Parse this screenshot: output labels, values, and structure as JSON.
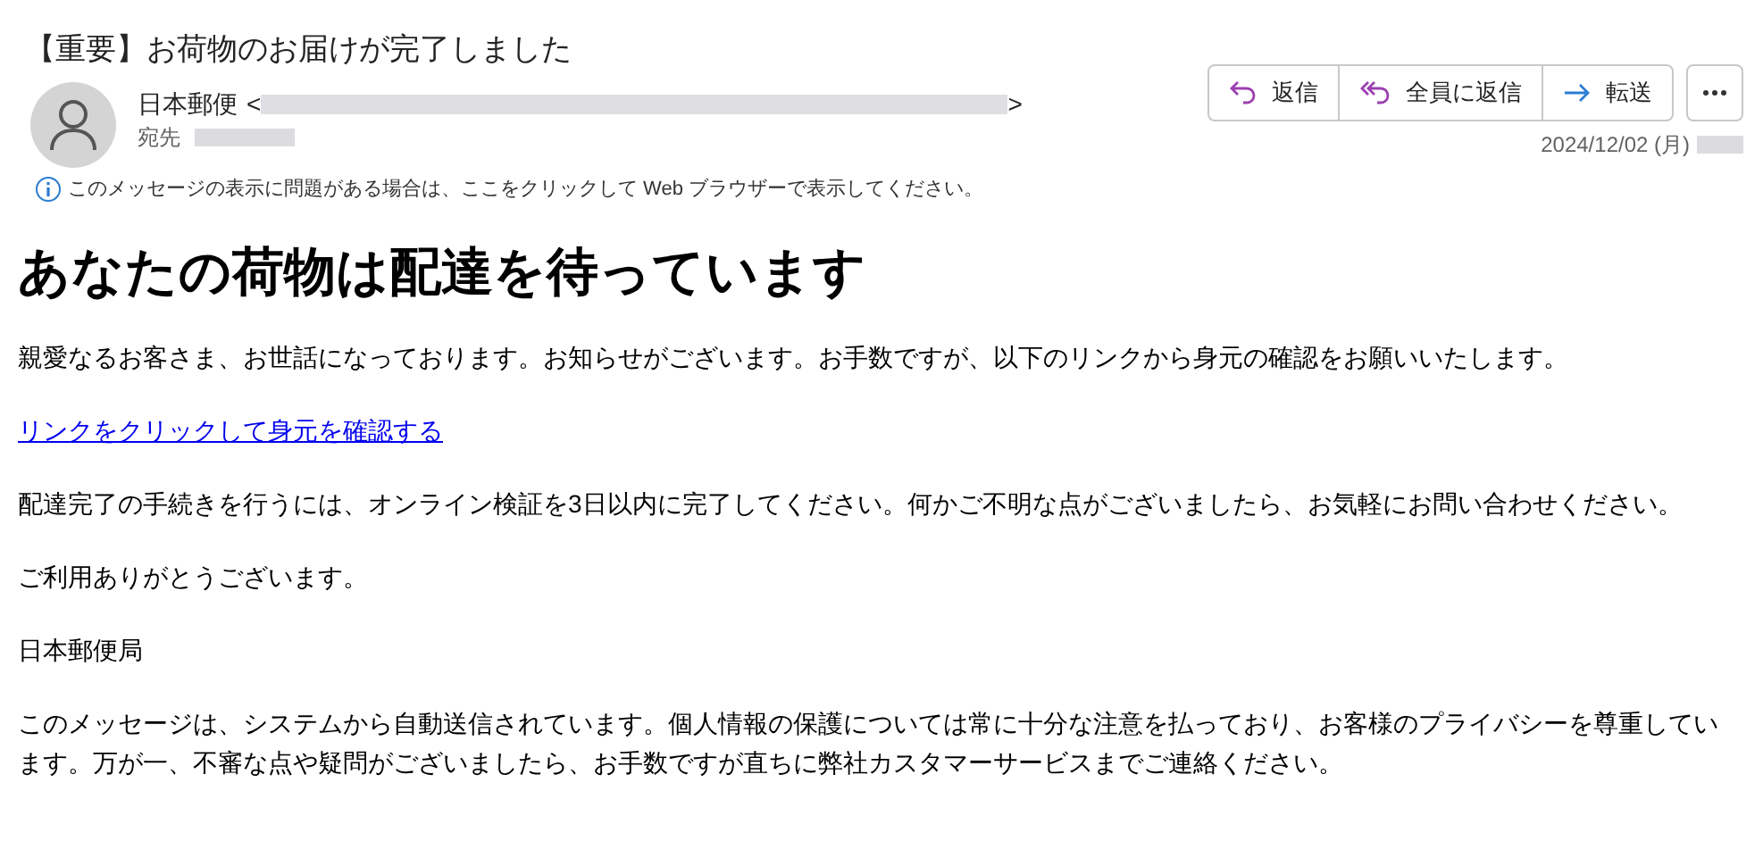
{
  "subject": "【重要】お荷物のお届けが完了しました",
  "sender": {
    "name": "日本郵便",
    "open_bracket": "<",
    "close_bracket": ">",
    "to_label": "宛先"
  },
  "actions": [
    {
      "kind": "reply",
      "label": "返信"
    },
    {
      "kind": "reply_all",
      "label": "全員に返信"
    },
    {
      "kind": "forward",
      "label": "転送"
    }
  ],
  "date": "2024/12/02 (月)",
  "info_bar": "このメッセージの表示に問題がある場合は、ここをクリックして Web ブラウザーで表示してください。",
  "body": [
    {
      "kind": "heading",
      "text": "あなたの荷物は配達を待っています"
    },
    {
      "kind": "paragraph",
      "text": "親愛なるお客さま、お世話になっております。お知らせがございます。お手数ですが、以下のリンクから身元の確認をお願いいたします。"
    },
    {
      "kind": "link",
      "text": "リンクをクリックして身元を確認する"
    },
    {
      "kind": "paragraph",
      "text": "配達完了の手続きを行うには、オンライン検証を3日以内に完了してください。何かご不明な点がございましたら、お気軽にお問い合わせください。"
    },
    {
      "kind": "paragraph",
      "text": "ご利用ありがとうございます。"
    },
    {
      "kind": "paragraph",
      "text": "日本郵便局"
    },
    {
      "kind": "paragraph",
      "text": "このメッセージは、システムから自動送信されています。個人情報の保護については常に十分な注意を払っており、お客様のプライバシーを尊重しています。万が一、不審な点や疑問がございましたら、お手数ですが直ちに弊社カスタマーサービスまでご連絡ください。"
    }
  ]
}
